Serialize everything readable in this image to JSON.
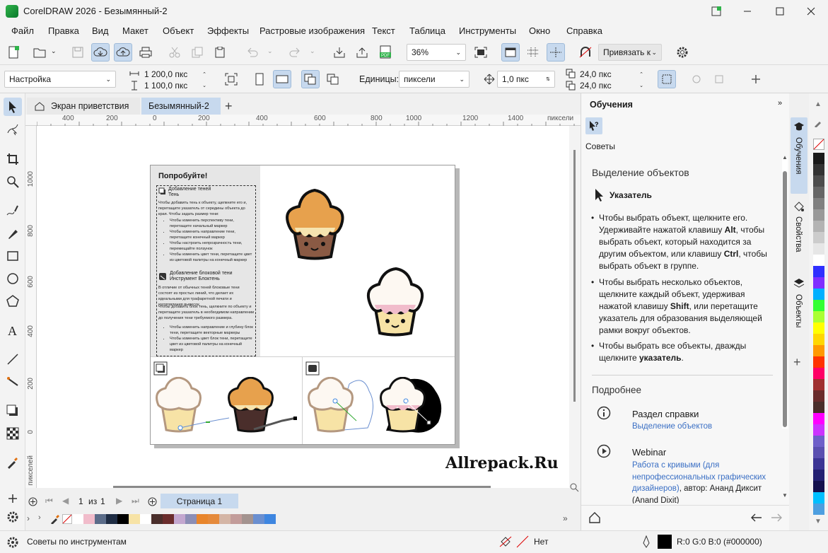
{
  "window": {
    "title": "CorelDRAW 2026 - Безымянный-2"
  },
  "menu": [
    "Файл",
    "Правка",
    "Вид",
    "Макет",
    "Объект",
    "Эффекты",
    "Растровые изображения",
    "Текст",
    "Таблица",
    "Инструменты",
    "Окно",
    "Справка"
  ],
  "toolbar": {
    "zoom": "36%",
    "snap_label": "Привязать к"
  },
  "propbar": {
    "preset": "Настройка",
    "width": "1 200,0 пкс",
    "height": "1 100,0 пкс",
    "units_label": "Единицы:",
    "units_value": "пиксели",
    "nudge": "1,0 пкс",
    "dup_x": "24,0 пкс",
    "dup_y": "24,0 пкс"
  },
  "tabs": {
    "welcome": "Экран приветствия",
    "doc": "Безымянный-2"
  },
  "ruler": {
    "h_ticks": [
      "400",
      "200",
      "0",
      "200",
      "400",
      "600",
      "800",
      "1000",
      "1200",
      "1400"
    ],
    "unit": "пиксели",
    "v_ticks": [
      "1000",
      "800",
      "600",
      "400",
      "200",
      "0"
    ],
    "v_unit": "пикселей"
  },
  "canvas": {
    "try_title": "Попробуйте!",
    "shadow_title": "Добавление теней",
    "shadow_sub": "Тень",
    "shadow_text": "Чтобы добавить тень к объекту, щелкните его и, перетащите указатель от середины объекта до края. Чтобы задать размер тени:",
    "shadow_bullets": [
      "Чтобы изменить перспективу тени, перетащите начальный маркер",
      "Чтобы изменить направление тени, перетащите конечный маркер",
      "Чтобы настроить непрозрачность тени, перемещайте ползунок",
      "Чтобы изменить цвет тени, перетащите цвет из цветовой палитры на конечный маркер"
    ],
    "block_title": "Добавление блоковой тени",
    "block_sub": "Инструмент Блоктень",
    "block_text1": "В отличие от обычных теней блоковые тени состоят из простых линий, что делает их идеальными для трафаретной печати и изготовления вывесок.",
    "block_text2": "Чтобы добавить блок тень, щелкните по объекту и перетащите указатель в необходимом направлении до получения тени требуемого размера.",
    "block_bullets": [
      "Чтобы изменить направление и глубину блок тени, перетащите векторные маркеры",
      "Чтобы изменить цвет блок тени, перетащите цвет из цветовой палитры на конечный маркер"
    ],
    "watermark": "Allrepack.Ru"
  },
  "pages": {
    "current": "1",
    "of_label": "из",
    "total": "1",
    "tab": "Страница 1"
  },
  "status": {
    "hint": "Советы по инструментам",
    "fill_label": "Нет",
    "color_value": "R:0 G:0 B:0 (#000000)"
  },
  "docker": {
    "title": "Обучения",
    "tips_label": "Советы",
    "heading": "Выделение объектов",
    "tool_name": "Указатель",
    "bullets": [
      [
        "Чтобы выбрать объект, щелкните его. Удерживайте нажатой клавишу ",
        "Alt",
        ", чтобы выбрать объект, который находится за другим объектом, или клавишу ",
        "Ctrl",
        ", чтобы выбрать объект в группе."
      ],
      [
        "Чтобы выбрать несколько объектов, щелкните каждый объект, удерживая нажатой клавишу ",
        "Shift",
        ", или перетащите указатель для образования выделяющей рамки вокруг объектов."
      ],
      [
        "Чтобы выбрать все объекты, дважды щелкните ",
        "указатель",
        "."
      ]
    ],
    "more_heading": "Подробнее",
    "help_title": "Раздел справки",
    "help_link": "Выделение объектов",
    "webinar_title": "Webinar",
    "webinar_link": "Работа с кривыми (для непрофессиональных графических дизайнеров)",
    "webinar_author": ", автор: Ананд Диксит (Anand Dixit)"
  },
  "side_tabs": [
    "Обучения",
    "Свойства",
    "Объекты"
  ],
  "colors": {
    "accent": "#c7d9ee",
    "link": "#3a6fc4"
  },
  "palette_h": [
    "#ffffff",
    "#f1bccb",
    "#5b6c89",
    "#1f2d44",
    "#000000",
    "#f7e3a6",
    "#ffffff",
    "#4a2e2b",
    "#6a2c2c",
    "#c3a7cf",
    "#8c8eb5",
    "#e8852b",
    "#e58a3b",
    "#d4b5a5",
    "#c29c9a",
    "#a3938f",
    "#6a8fd0",
    "#3e86e0"
  ],
  "palette_v": [
    "#1a1a1a",
    "#333333",
    "#4d4d4d",
    "#666666",
    "#808080",
    "#999999",
    "#b3b3b3",
    "#cccccc",
    "#e6e6e6",
    "#ffffff",
    "#2f2fff",
    "#7f2fff",
    "#00b0ff",
    "#33ff33",
    "#aaff33",
    "#ffff00",
    "#ffd700",
    "#ff9900",
    "#ff3300",
    "#ff0066",
    "#a03030",
    "#6a2c2c",
    "#4a2e2b",
    "#ff00ff",
    "#cc33ff",
    "#6e5fc9",
    "#5a4fb0",
    "#3b3494",
    "#232072",
    "#14104e",
    "#00bfff",
    "#4d9fe0"
  ]
}
